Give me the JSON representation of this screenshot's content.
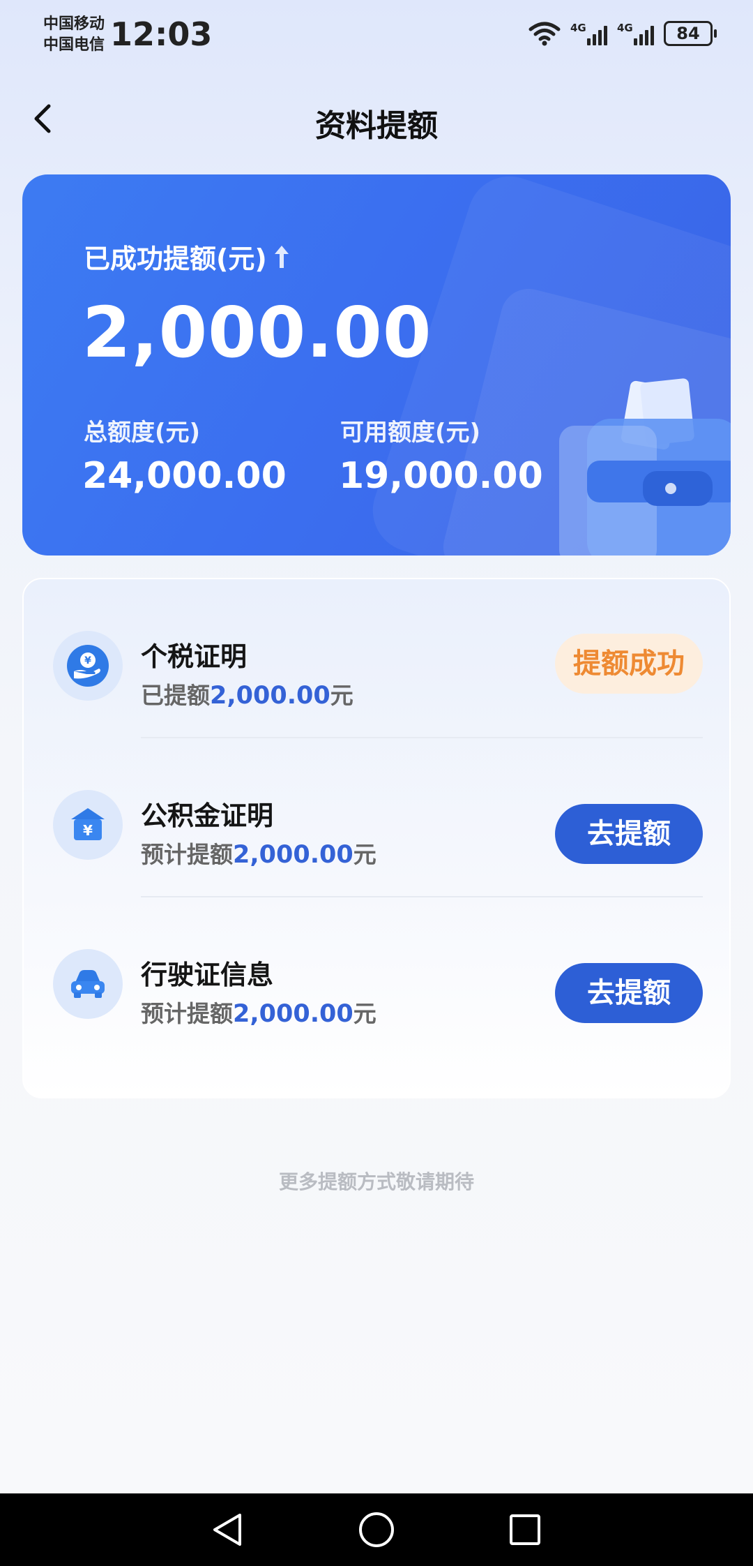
{
  "status_bar": {
    "carrier_1": "中国移动",
    "carrier_2": "中国电信",
    "time": "12:03",
    "net_1": "4G",
    "net_2": "4G",
    "battery": "84"
  },
  "header": {
    "title": "资料提额"
  },
  "hero": {
    "label": "已成功提额(元)",
    "amount": "2,000.00",
    "total_label": "总额度(元)",
    "total_value": "24,000.00",
    "available_label": "可用额度(元)",
    "available_value": "19,000.00"
  },
  "items": [
    {
      "title": "个税证明",
      "desc_prefix": "已提额",
      "amount": "2,000.00",
      "suffix": "元",
      "status": "提额成功",
      "icon": "hand-yuan-icon"
    },
    {
      "title": "公积金证明",
      "desc_prefix": "预计提额",
      "amount": "2,000.00",
      "suffix": "元",
      "action": "去提额",
      "icon": "house-yuan-icon"
    },
    {
      "title": "行驶证信息",
      "desc_prefix": "预计提额",
      "amount": "2,000.00",
      "suffix": "元",
      "action": "去提额",
      "icon": "car-icon"
    }
  ],
  "footer_note": "更多提额方式敬请期待",
  "colors": {
    "primary": "#2d5fd6",
    "hero_bg": "#3b6ff0",
    "success_text": "#ee8a33",
    "success_bg": "#fdeede",
    "amount_blue": "#3462d6"
  }
}
